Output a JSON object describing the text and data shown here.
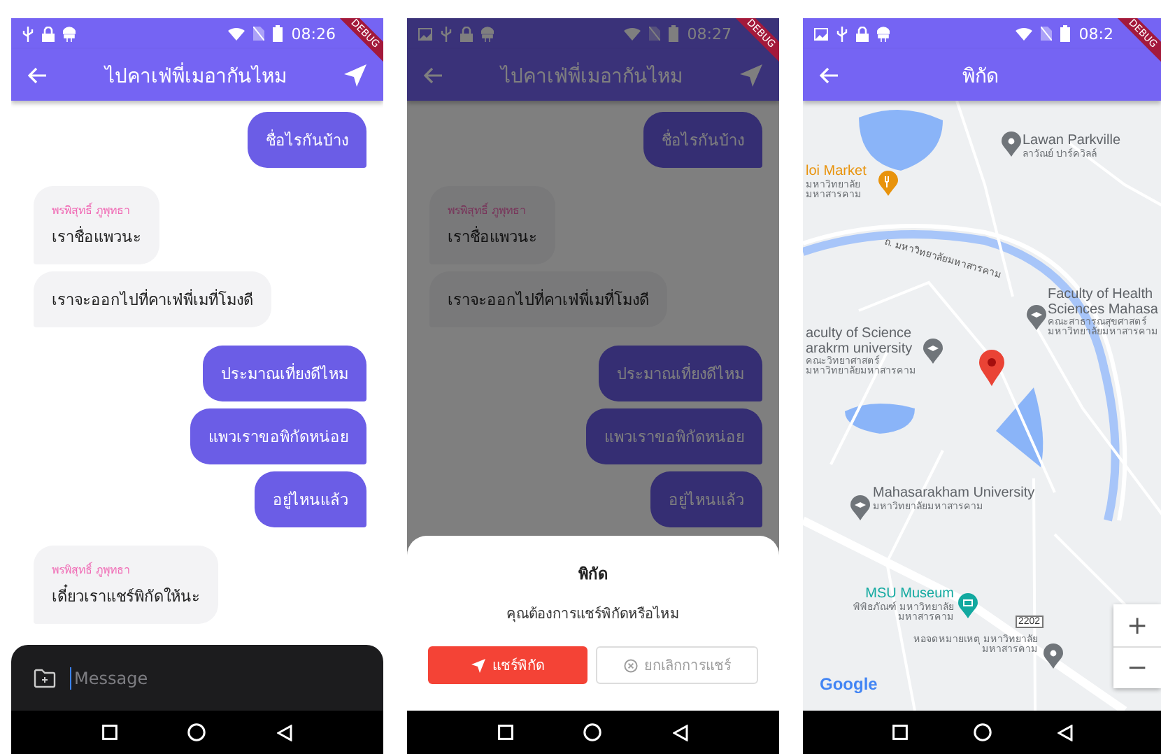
{
  "screens": [
    {
      "kind": "chat",
      "dimmed": false,
      "status_bar": {
        "time": "08:26",
        "image_notification": false,
        "debug": "DEBUG"
      },
      "app_bar": {
        "title": "ไปคาเฟ่พี่เมอากันไหม",
        "location_action": true
      },
      "messages": [
        {
          "outgoing": true,
          "text": "ชื่อไรกันบ้าง"
        },
        {
          "outgoing": false,
          "sender": "พรพิสุทธิ์ ภูพุทธา",
          "text": "เราชื่อแพวนะ"
        },
        {
          "outgoing": false,
          "text": "เราจะออกไปที่คาเฟ่พี่เมที่โมงดี"
        },
        {
          "outgoing": true,
          "text": "ประมาณเที่ยงดีไหม"
        },
        {
          "outgoing": true,
          "text": "แพวเราขอพิกัดหน่อย"
        },
        {
          "outgoing": true,
          "text": "อยู่ไหนแล้ว"
        },
        {
          "outgoing": false,
          "sender": "พรพิสุทธิ์ ภูพุทธา",
          "text": "เดี๋ยวเราแชร์พิกัดให้นะ"
        }
      ],
      "composer": {
        "placeholder": "Message"
      }
    },
    {
      "kind": "chat",
      "dimmed": true,
      "status_bar": {
        "time": "08:27",
        "image_notification": true,
        "debug": "DEBUG"
      },
      "app_bar": {
        "title": "ไปคาเฟ่พี่เมอากันไหม",
        "location_action": true
      },
      "messages": [
        {
          "outgoing": true,
          "text": "ชื่อไรกันบ้าง"
        },
        {
          "outgoing": false,
          "sender": "พรพิสุทธิ์ ภูพุทธา",
          "text": "เราชื่อแพวนะ"
        },
        {
          "outgoing": false,
          "text": "เราจะออกไปที่คาเฟ่พี่เมที่โมงดี"
        },
        {
          "outgoing": true,
          "text": "ประมาณเที่ยงดีไหม"
        },
        {
          "outgoing": true,
          "text": "แพวเราขอพิกัดหน่อย"
        },
        {
          "outgoing": true,
          "text": "อยู่ไหนแล้ว"
        }
      ],
      "sheet": {
        "title": "พิกัด",
        "message": "คุณต้องการแชร์พิกัดหรือไหม",
        "buttons": [
          {
            "label": "แชร์พิกัด",
            "kind": "primary"
          },
          {
            "label": "ยกเลิกการแชร์",
            "kind": "secondary"
          }
        ]
      }
    },
    {
      "kind": "map",
      "dimmed": false,
      "status_bar": {
        "time": "08:2",
        "image_notification": true,
        "debug": "DEBUG"
      },
      "app_bar": {
        "title": "พิกัด",
        "location_action": false
      },
      "map": {
        "road_label": "ถ. มหาวิทยาลัยมหาสารคาม",
        "road_number": "2202",
        "logo": "Google",
        "zoom_controls": [
          "+",
          "−"
        ],
        "places": [
          {
            "kind": "place",
            "name": "Lawan Parkville",
            "subtitle": "ลาวัณย์ ปาร์ควิลล์",
            "color": "#70757a"
          },
          {
            "kind": "food",
            "name": "loi Market",
            "subtitle": "มหาวิทยาลัย มหาสารคาม",
            "color": "#e8930c"
          },
          {
            "kind": "school",
            "name": "Faculty of Health Sciences Mahasa",
            "subtitle": "คณะสาธารณสุขศาสตร์ มหาวิทยาลัยมหาสารคาม",
            "color": "#70757a"
          },
          {
            "kind": "school",
            "name": "aculty of Science arakrm university",
            "subtitle": "คณะวิทยาศาสตร์ มหาวิทยาลัยมหาสารคาม",
            "color": "#70757a"
          },
          {
            "kind": "school",
            "name": "Mahasarakham University",
            "subtitle": "มหาวิทยาลัยมหาสารคาม",
            "color": "#70757a"
          },
          {
            "kind": "museum",
            "name": "MSU Museum",
            "subtitle": "พิพิธภัณฑ์ มหาวิทยาลัยมหาสารคาม",
            "color": "#12a9a0"
          },
          {
            "kind": "place",
            "subtitle": "หอจดหมายเหตุ มหาวิทยาลัยมหาสารคาม",
            "color": "#70757a"
          }
        ]
      }
    }
  ]
}
